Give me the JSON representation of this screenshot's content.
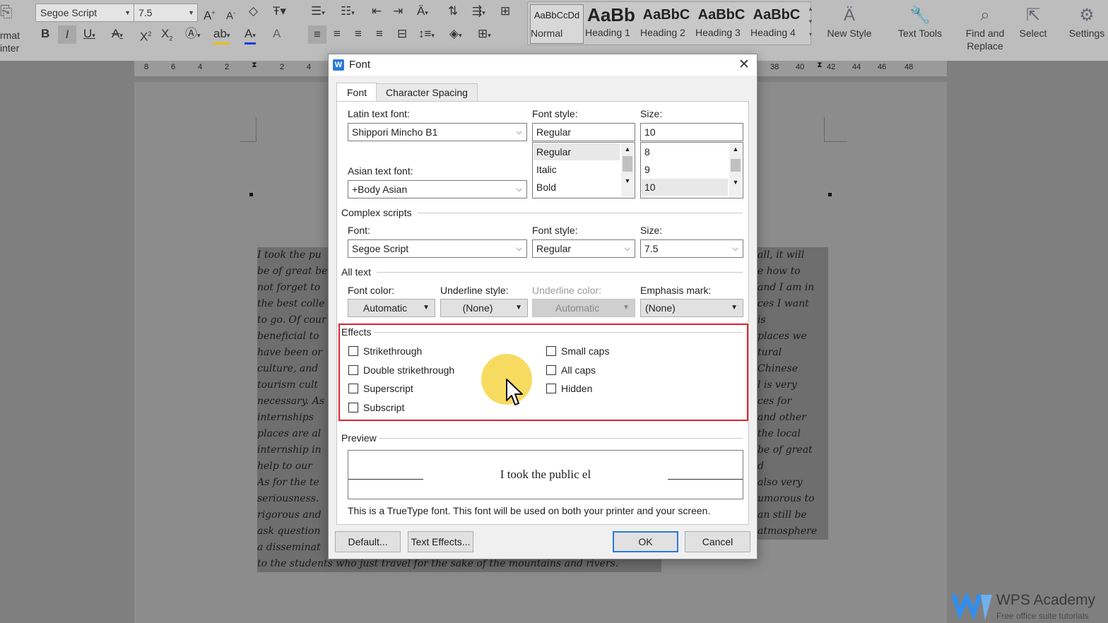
{
  "ribbon": {
    "left_cut_label_1": "rmat",
    "left_cut_label_2": "inter",
    "font_name": "Segoe Script",
    "font_size": "7.5",
    "styles": [
      {
        "preview": "AaBbCcDd",
        "label": "Normal"
      },
      {
        "preview": "AaBb",
        "label": "Heading 1"
      },
      {
        "preview": "AaBbC",
        "label": "Heading 2"
      },
      {
        "preview": "AaBbC",
        "label": "Heading 3"
      },
      {
        "preview": "AaBbC",
        "label": "Heading 4"
      }
    ],
    "new_style": "New Style",
    "text_tools": "Text Tools",
    "find_replace_1": "Find and",
    "find_replace_2": "Replace",
    "select": "Select",
    "settings": "Settings"
  },
  "ruler": {
    "left_ticks": [
      "8",
      "6",
      "4",
      "2",
      "2",
      "4"
    ],
    "right_ticks": [
      "38",
      "40",
      "42",
      "44",
      "46",
      "48"
    ]
  },
  "document": {
    "left_lines": [
      "I took the pu",
      "be of great be",
      "not forget to",
      "the best colle",
      "to go. Of cour",
      "beneficial to",
      "have been or",
      "culture, and",
      "tourism cult",
      "necessary. As",
      "internships",
      "places are al",
      "internship in",
      "help to our",
      "As for the te",
      "seriousness.",
      "rigorous and",
      "ask question",
      "a disseminat"
    ],
    "right_lines": [
      "all, it will",
      "e how to",
      "and I am in",
      "ces I want",
      "is",
      "places we",
      "tural",
      "Chinese",
      "l is very",
      "ces for",
      "and other",
      "the local",
      "be of great",
      "d",
      "also very",
      "umorous to",
      "an still be",
      "atmosphere"
    ],
    "last_line": "to the students who just travel for the sake of the mountains and rivers."
  },
  "dialog": {
    "title": "Font",
    "tabs": [
      "Font",
      "Character Spacing"
    ],
    "latin_font_label": "Latin text font:",
    "latin_font_value": "Shippori Mincho B1",
    "font_style_label": "Font style:",
    "font_style_value": "Regular",
    "font_style_options": [
      "Regular",
      "Italic",
      "Bold"
    ],
    "size_label": "Size:",
    "size_value": "10",
    "size_options": [
      "8",
      "9",
      "10"
    ],
    "asian_font_label": "Asian text font:",
    "asian_font_value": "+Body Asian",
    "complex_section": "Complex scripts",
    "complex_font_label": "Font:",
    "complex_font_value": "Segoe Script",
    "complex_style_label": "Font style:",
    "complex_style_value": "Regular",
    "complex_size_label": "Size:",
    "complex_size_value": "7.5",
    "all_text_section": "All text",
    "font_color_label": "Font color:",
    "font_color_value": "Automatic",
    "underline_style_label": "Underline style:",
    "underline_style_value": "(None)",
    "underline_color_label": "Underline color:",
    "underline_color_value": "Automatic",
    "emphasis_label": "Emphasis mark:",
    "emphasis_value": "(None)",
    "effects_section": "Effects",
    "effects_left": [
      "Strikethrough",
      "Double strikethrough",
      "Superscript",
      "Subscript"
    ],
    "effects_right": [
      "Small caps",
      "All caps",
      "Hidden"
    ],
    "preview_section": "Preview",
    "preview_text": "I took the public el",
    "note": "This is a TrueType font. This font will be used on both your printer and your screen.",
    "buttons": {
      "default": "Default...",
      "text_effects": "Text Effects...",
      "ok": "OK",
      "cancel": "Cancel"
    }
  },
  "watermark": {
    "brand": "WPS Academy",
    "tagline": "Free office suite tutorials"
  },
  "colors": {
    "highlight_red": "#e02030",
    "cursor_halo": "#f5d23a",
    "accent_blue": "#2a7ad8"
  }
}
